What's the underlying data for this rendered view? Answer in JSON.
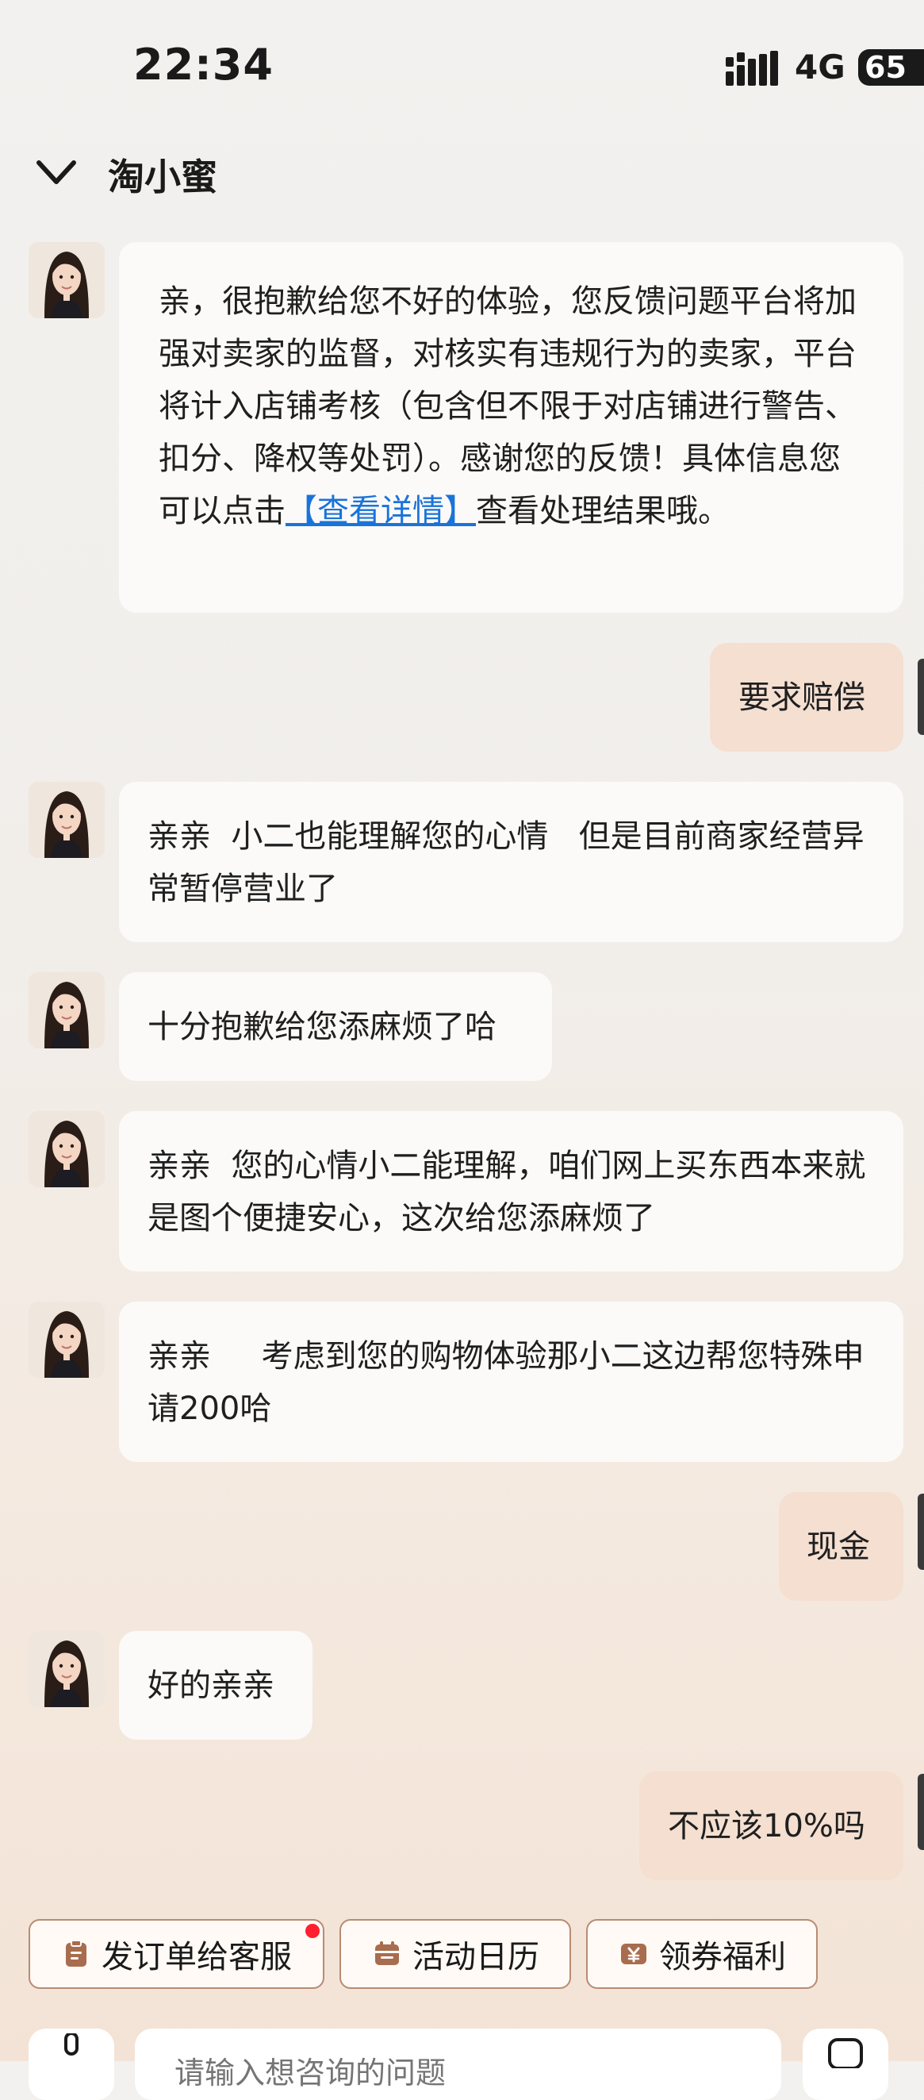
{
  "status_bar": {
    "time": "22:34",
    "network": "4G",
    "battery": "65"
  },
  "header": {
    "title": "淘小蜜"
  },
  "messages": [
    {
      "sender": "agent",
      "text_before_link": "亲，很抱歉给您不好的体验，您反馈问题平台将加强对卖家的监督，对核实有违规行为的卖家，平台将计入店铺考核（包含但不限于对店铺进行警告、扣分、降权等处罚）。感谢您的反馈！具体信息您可以点击",
      "link": "【查看详情】",
      "text_after_link": "查看处理结果哦。"
    },
    {
      "sender": "user",
      "text": "要求赔偿"
    },
    {
      "sender": "agent",
      "text": "亲亲  小二也能理解您的心情   但是目前商家经营异常暂停营业了"
    },
    {
      "sender": "agent",
      "text": "十分抱歉给您添麻烦了哈"
    },
    {
      "sender": "agent",
      "text": "亲亲  您的心情小二能理解，咱们网上买东西本来就是图个便捷安心，这次给您添麻烦了"
    },
    {
      "sender": "agent",
      "text": "亲亲     考虑到您的购物体验那小二这边帮您特殊申请200哈"
    },
    {
      "sender": "user",
      "text": "现金"
    },
    {
      "sender": "agent",
      "text": "好的亲亲"
    },
    {
      "sender": "user",
      "text": "不应该10%吗"
    }
  ],
  "quick_actions": [
    {
      "label": "发订单给客服",
      "icon": "clipboard-icon",
      "has_badge": true
    },
    {
      "label": "活动日历",
      "icon": "calendar-icon",
      "has_badge": false
    },
    {
      "label": "领券福利",
      "icon": "coupon-yuan-icon",
      "has_badge": false
    }
  ],
  "input": {
    "placeholder": "请输入想咨询的问题"
  },
  "colors": {
    "user_bubble": "#f4dfd1",
    "agent_bubble": "#fbfaf9",
    "link": "#1a73d9",
    "accent_brown": "#b98b73",
    "badge_red": "#ff1f2f"
  }
}
